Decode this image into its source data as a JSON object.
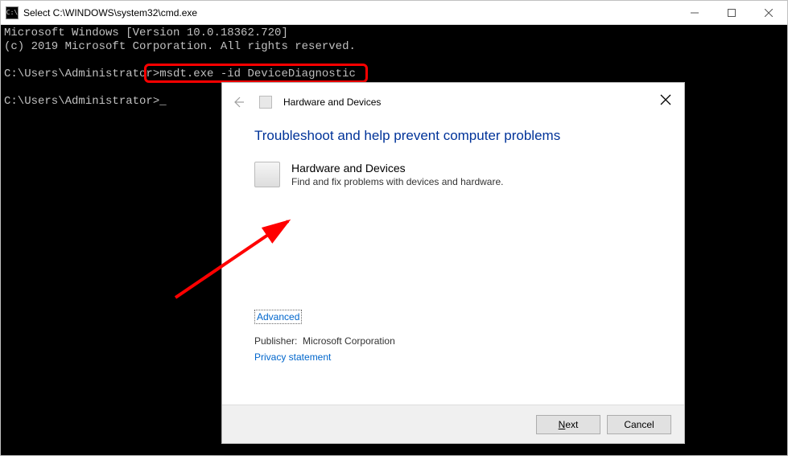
{
  "cmd": {
    "title": "Select C:\\WINDOWS\\system32\\cmd.exe",
    "line1": "Microsoft Windows [Version 10.0.18362.720]",
    "line2": "(c) 2019 Microsoft Corporation. All rights reserved.",
    "prompt1": "C:\\Users\\Administrator>",
    "command": "msdt.exe -id DeviceDiagnostic",
    "prompt2": "C:\\Users\\Administrator>"
  },
  "dialog": {
    "header_title": "Hardware and Devices",
    "main_heading": "Troubleshoot and help prevent computer problems",
    "item_title": "Hardware and Devices",
    "item_desc": "Find and fix problems with devices and hardware.",
    "advanced": "Advanced",
    "publisher_label": "Publisher:",
    "publisher_value": "Microsoft Corporation",
    "privacy": "Privacy statement",
    "next_prefix": "N",
    "next_suffix": "ext",
    "cancel": "Cancel"
  }
}
